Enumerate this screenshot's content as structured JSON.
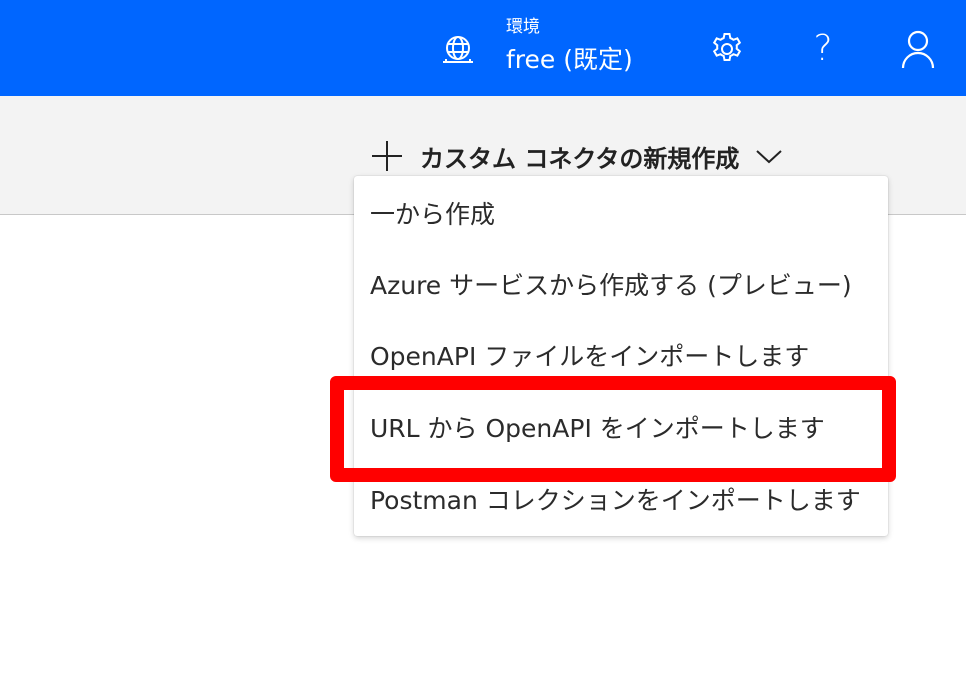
{
  "header": {
    "environment_label": "環境",
    "environment_value": "free (既定)",
    "bar_color": "#0066ff",
    "icons": [
      "environment-globe-icon",
      "gear-icon",
      "help-icon",
      "user-icon"
    ],
    "help_glyph": "?"
  },
  "commandbar": {
    "new_connector_label": "カスタム コネクタの新規作成",
    "icons": [
      "plus-icon",
      "chevron-down-icon"
    ]
  },
  "dropdown": {
    "items": [
      {
        "label": "一から作成"
      },
      {
        "label": "Azure サービスから作成する (プレビュー)"
      },
      {
        "label": "OpenAPI ファイルをインポートします"
      },
      {
        "label": "URL から OpenAPI をインポートします"
      },
      {
        "label": "Postman コレクションをインポートします"
      }
    ],
    "highlighted_index": 3,
    "highlight_color": "#ff0000"
  }
}
